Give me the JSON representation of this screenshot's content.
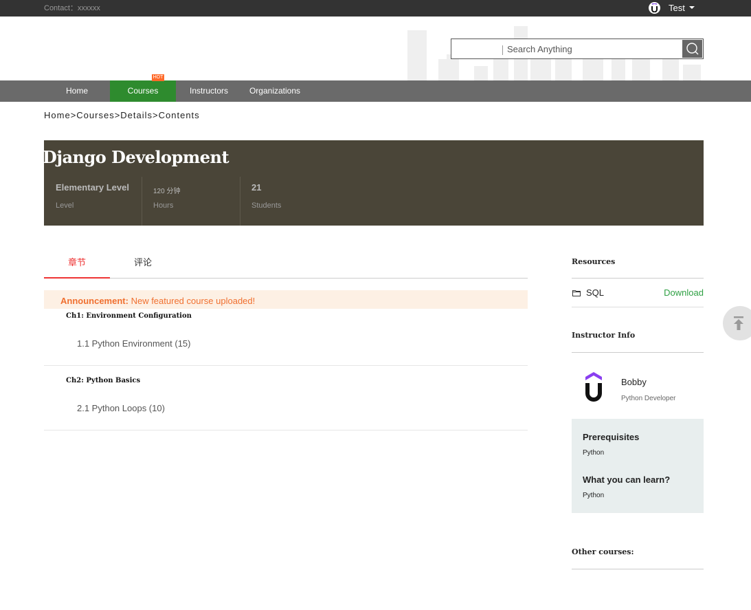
{
  "topbar": {
    "contact_label": "Contact：xxxxxx",
    "username": "Test"
  },
  "search": {
    "placeholder": "Search Anything",
    "value": ""
  },
  "nav": {
    "items": [
      {
        "label": "Home"
      },
      {
        "label": "Courses",
        "active": true
      },
      {
        "label": "Instructors"
      },
      {
        "label": "Organizations"
      }
    ],
    "hot_badge": "HOT",
    "active_color": "#2e8b2e"
  },
  "breadcrumb": [
    "Home",
    ">",
    "Courses",
    ">",
    "Details",
    ">",
    "Contents"
  ],
  "course": {
    "title": "Django Development",
    "level_value": "Elementary Level",
    "level_label": "Level",
    "hours_value": "120 分钟",
    "hours_label": "Hours",
    "students_value": "21",
    "students_label": "Students"
  },
  "tabs": [
    {
      "label": "章节",
      "active": true
    },
    {
      "label": "评论",
      "active": false
    }
  ],
  "announcement": {
    "prefix": "Announcement:",
    "text": "New featured course uploaded!"
  },
  "chapters": [
    {
      "title": "Ch1: Environment Configuration",
      "lessons": [
        "1.1 Python Environment (15)"
      ]
    },
    {
      "title": "Ch2: Python Basics",
      "lessons": [
        "2.1 Python Loops (10)"
      ]
    }
  ],
  "sidebar": {
    "resources_title": "Resources",
    "resources": [
      {
        "name": "SQL",
        "action": "Download"
      }
    ],
    "instructor_title": "Instructor Info",
    "instructor": {
      "name": "Bobby",
      "title": "Python Developer"
    },
    "prerequisites_title": "Prerequisites",
    "prerequisites": "Python",
    "learn_title": "What you can learn?",
    "learn": "Python",
    "other_courses_title": "Other courses:"
  },
  "icons": [
    "user-avatar-icon",
    "caret-down-icon",
    "search-icon",
    "folder-icon",
    "instructor-logo-icon",
    "back-to-top-icon"
  ]
}
